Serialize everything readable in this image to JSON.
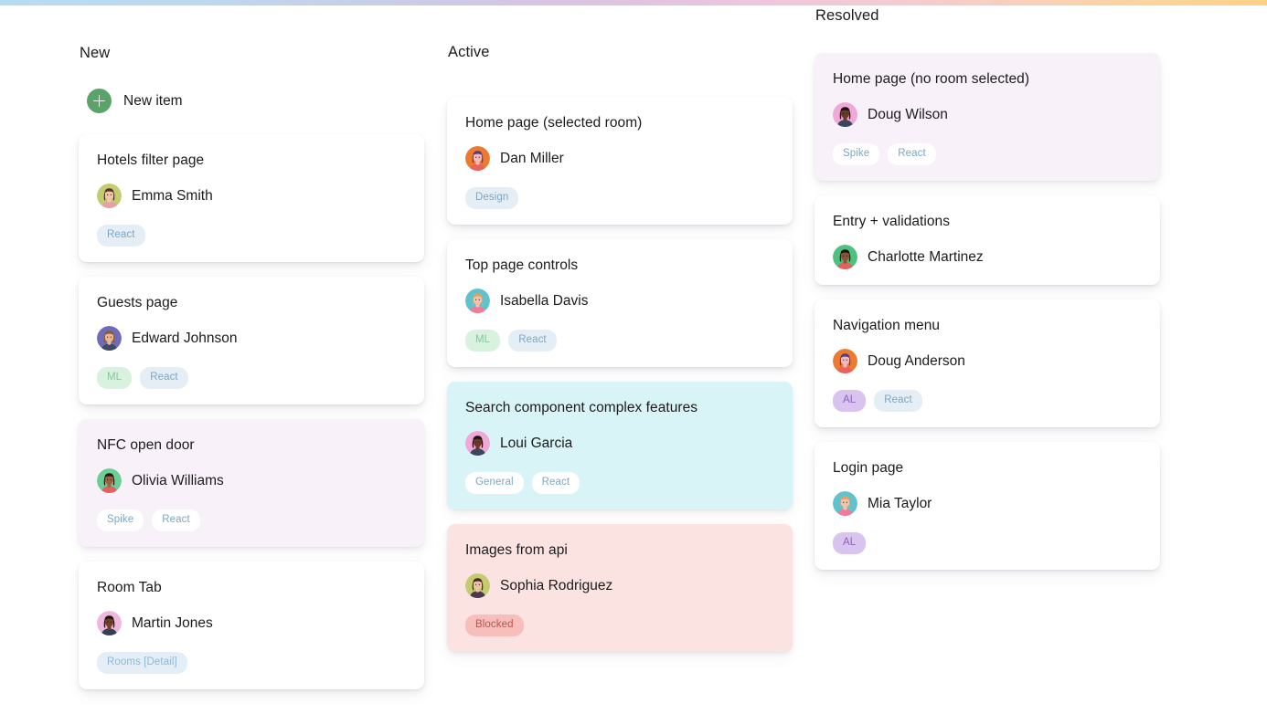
{
  "top_bar": {
    "gradient_from": "#b6dcf2",
    "gradient_mid": "#e0c3e0",
    "gradient_to": "#fbd285"
  },
  "board": {
    "columns": [
      {
        "id": "new",
        "title": "New",
        "accent": "#5aa469",
        "new_item": {
          "label": "New item",
          "icon": "plus-icon",
          "color": "#5aa469"
        },
        "cards": [
          {
            "title": "Hotels filter page",
            "assignee": "Emma Smith",
            "avatar": {
              "bg": "#c3cc6e",
              "skin": "#f0c7a8",
              "hair": "#5b2f2a",
              "top": "#e8a0a4"
            },
            "tint": "white",
            "tags": [
              {
                "label": "React",
                "style": "react"
              }
            ]
          },
          {
            "title": "Guests page",
            "assignee": "Edward Johnson",
            "avatar": {
              "bg": "#6f6bb5",
              "skin": "#e8b993",
              "hair": "#8c5a3c",
              "top": "#3d4a63"
            },
            "tint": "white",
            "tags": [
              {
                "label": "ML",
                "style": "ml"
              },
              {
                "label": "React",
                "style": "react"
              }
            ]
          },
          {
            "title": "NFC open door",
            "assignee": "Olivia Williams",
            "avatar": {
              "bg": "#6bcf95",
              "skin": "#9c6140",
              "hair": "#241716",
              "top": "#e2605f"
            },
            "tint": "lavender",
            "tags": [
              {
                "label": "Spike",
                "style": "spike",
                "onwhite": true
              },
              {
                "label": "React",
                "style": "react",
                "onwhite": true
              }
            ]
          },
          {
            "title": "Room Tab",
            "assignee": "Martin Jones",
            "avatar": {
              "bg": "#efb7dd",
              "skin": "#70402b",
              "hair": "#1d1212",
              "top": "#33405a"
            },
            "tint": "white",
            "tags": [
              {
                "label": "Rooms [Detail]",
                "style": "rooms"
              }
            ]
          }
        ]
      },
      {
        "id": "active",
        "title": "Active",
        "cards": [
          {
            "title": "Home page (selected room)",
            "assignee": "Dan Miller",
            "avatar": {
              "bg": "#ec7a31",
              "skin": "#f4b8c0",
              "hair": "#5a3b79",
              "top": "#e8645a"
            },
            "tint": "white",
            "tags": [
              {
                "label": "Design",
                "style": "design"
              }
            ]
          },
          {
            "title": "Top page controls",
            "assignee": "Isabella Davis",
            "avatar": {
              "bg": "#5fc2ce",
              "skin": "#f4c3a8",
              "hair": "#e0a060",
              "top": "#f07c9a"
            },
            "tint": "white",
            "tags": [
              {
                "label": "ML",
                "style": "ml"
              },
              {
                "label": "React",
                "style": "react"
              }
            ]
          },
          {
            "title": "Search component complex features",
            "assignee": "Loui Garcia",
            "avatar": {
              "bg": "#efa8d8",
              "skin": "#6b3a26",
              "hair": "#1b1010",
              "top": "#3a4660"
            },
            "tint": "cyan",
            "tags": [
              {
                "label": "General",
                "style": "general",
                "onwhite": true
              },
              {
                "label": "React",
                "style": "react",
                "onwhite": true
              }
            ]
          },
          {
            "title": "Images from api",
            "assignee": "Sophia Rodriguez",
            "avatar": {
              "bg": "#c3cc6e",
              "skin": "#eec3a4",
              "hair": "#4a2620",
              "top": "#4a3a50"
            },
            "tint": "pink",
            "tags": [
              {
                "label": "Blocked",
                "style": "blocked"
              }
            ]
          }
        ]
      },
      {
        "id": "resolved",
        "title": "Resolved",
        "cards": [
          {
            "title": "Home page (no room selected)",
            "assignee": "Doug Wilson",
            "avatar": {
              "bg": "#efa8d8",
              "skin": "#6b3a26",
              "hair": "#1b1010",
              "top": "#3a4660"
            },
            "tint": "lavender",
            "tags": [
              {
                "label": "Spike",
                "style": "spike",
                "onwhite": true
              },
              {
                "label": "React",
                "style": "react",
                "onwhite": true
              }
            ]
          },
          {
            "title": "Entry + validations",
            "assignee": "Charlotte Martinez",
            "avatar": {
              "bg": "#4fc07f",
              "skin": "#8a5438",
              "hair": "#1a1010",
              "top": "#e2605f"
            },
            "tint": "white",
            "tags": []
          },
          {
            "title": "Navigation menu",
            "assignee": "Doug Anderson",
            "avatar": {
              "bg": "#ec7a31",
              "skin": "#f4b8c0",
              "hair": "#5a3b79",
              "top": "#e8645a"
            },
            "tint": "white",
            "tags": [
              {
                "label": "AL",
                "style": "al"
              },
              {
                "label": "React",
                "style": "react"
              }
            ]
          },
          {
            "title": "Login page",
            "assignee": "Mia Taylor",
            "avatar": {
              "bg": "#5fc2ce",
              "skin": "#f4c3a8",
              "hair": "#e0a060",
              "top": "#f07c9a"
            },
            "tint": "white",
            "tags": [
              {
                "label": "AL",
                "style": "al"
              }
            ]
          }
        ]
      }
    ]
  }
}
